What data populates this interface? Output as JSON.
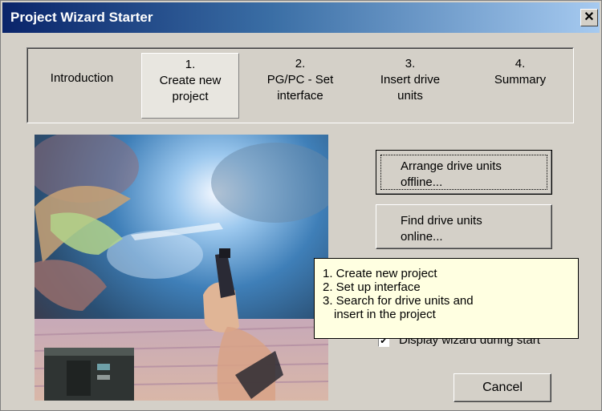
{
  "window": {
    "title": "Project Wizard Starter",
    "close_glyph": "✕"
  },
  "steps": [
    {
      "number": "",
      "label": "Introduction",
      "active": false
    },
    {
      "number": "1.",
      "label": "Create new project",
      "active": true
    },
    {
      "number": "2.",
      "label": "PG/PC - Set interface",
      "active": false
    },
    {
      "number": "3.",
      "label": "Insert drive units",
      "active": false
    },
    {
      "number": "4.",
      "label": "Summary",
      "active": false
    }
  ],
  "picture": {
    "icon": "wizard-illustration"
  },
  "buttons": {
    "arrange_offline": "Arrange drive units offline...",
    "find_online": "Find drive units online...",
    "cancel": "Cancel"
  },
  "checkbox": {
    "checked": true,
    "glyph": "✔",
    "label": "Display wizard during start"
  },
  "tooltip": {
    "lines": [
      "1. Create new project",
      "2. Set up interface",
      "3. Search for drive units and",
      "   insert in the project"
    ]
  },
  "colors": {
    "face": "#d4d0c8",
    "title_start": "#0a246a",
    "title_end": "#a6caf0",
    "tooltip_bg": "#ffffe1"
  }
}
